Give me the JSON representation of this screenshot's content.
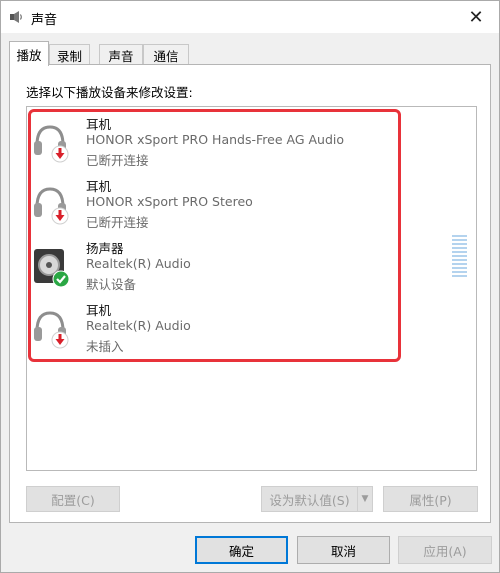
{
  "window": {
    "title": "声音",
    "close_glyph": "✕"
  },
  "tabs": [
    {
      "label": "播放"
    },
    {
      "label": "录制"
    },
    {
      "label": "声音"
    },
    {
      "label": "通信"
    }
  ],
  "panel": {
    "instruction": "选择以下播放设备来修改设置:"
  },
  "devices": [
    {
      "name": "耳机",
      "description": "HONOR xSport PRO Hands-Free AG Audio",
      "status": "已断开连接",
      "icon": "headphones-icon",
      "badge": "red-down-arrow"
    },
    {
      "name": "耳机",
      "description": "HONOR xSport PRO Stereo",
      "status": "已断开连接",
      "icon": "headphones-icon",
      "badge": "red-down-arrow"
    },
    {
      "name": "扬声器",
      "description": "Realtek(R) Audio",
      "status": "默认设备",
      "icon": "speaker-icon",
      "badge": "green-check"
    },
    {
      "name": "耳机",
      "description": "Realtek(R) Audio",
      "status": "未插入",
      "icon": "headphones-icon",
      "badge": "red-down-arrow"
    }
  ],
  "buttons": {
    "configure": "配置(C)",
    "set_default": "设为默认值(S)",
    "properties": "属性(P)",
    "ok": "确定",
    "cancel": "取消",
    "apply": "应用(A)"
  },
  "colors": {
    "highlight_border": "#e8323a",
    "primary_focus": "#0078d7",
    "default_check": "#2aa744",
    "disconnected_arrow": "#d9202a"
  }
}
